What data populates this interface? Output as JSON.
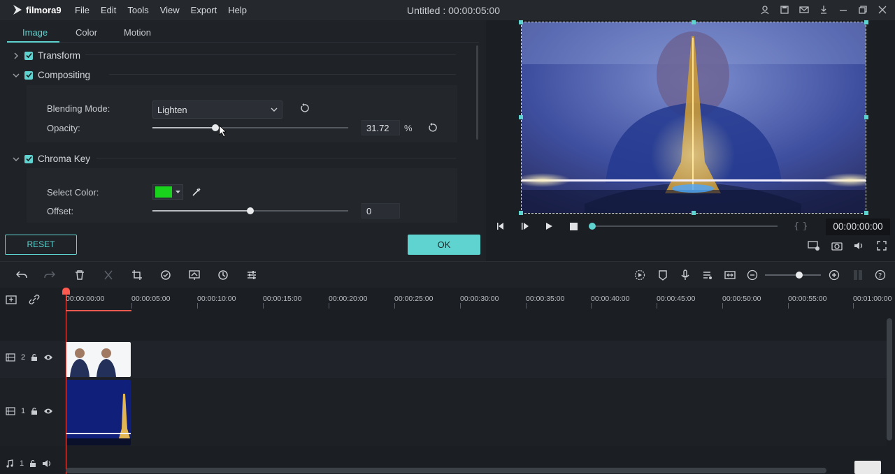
{
  "app": {
    "name": "filmora9",
    "window_title": "Untitled : 00:00:05:00"
  },
  "menu": [
    "File",
    "Edit",
    "Tools",
    "View",
    "Export",
    "Help"
  ],
  "tabs": [
    "Image",
    "Color",
    "Motion"
  ],
  "sections": {
    "transform": "Transform",
    "compositing": "Compositing",
    "chroma_key": "Chroma Key"
  },
  "compositing": {
    "blending_label": "Blending Mode:",
    "blending_value": "Lighten",
    "opacity_label": "Opacity:",
    "opacity_value": "31.72",
    "opacity_unit": "%",
    "opacity_fraction": 0.32
  },
  "chroma": {
    "select_color_label": "Select Color:",
    "select_color": "#18d21b",
    "offset_label": "Offset:",
    "offset_value": "0",
    "offset_fraction": 0.5
  },
  "buttons": {
    "reset": "RESET",
    "ok": "OK"
  },
  "player": {
    "timecode": "00:00:00:00"
  },
  "ruler": [
    "00:00:00:00",
    "00:00:05:00",
    "00:00:10:00",
    "00:00:15:00",
    "00:00:20:00",
    "00:00:25:00",
    "00:00:30:00",
    "00:00:35:00",
    "00:00:40:00",
    "00:00:45:00",
    "00:00:50:00",
    "00:00:55:00",
    "00:01:00:00"
  ],
  "tracks": {
    "track2": {
      "num": "2",
      "clip": "thinking"
    },
    "track1": {
      "num": "1",
      "clip": "eiffel-tower"
    },
    "audio1": {
      "num": "1"
    }
  },
  "colors": {
    "accent": "#5fd3cf",
    "playhead": "#ff5a4f"
  }
}
